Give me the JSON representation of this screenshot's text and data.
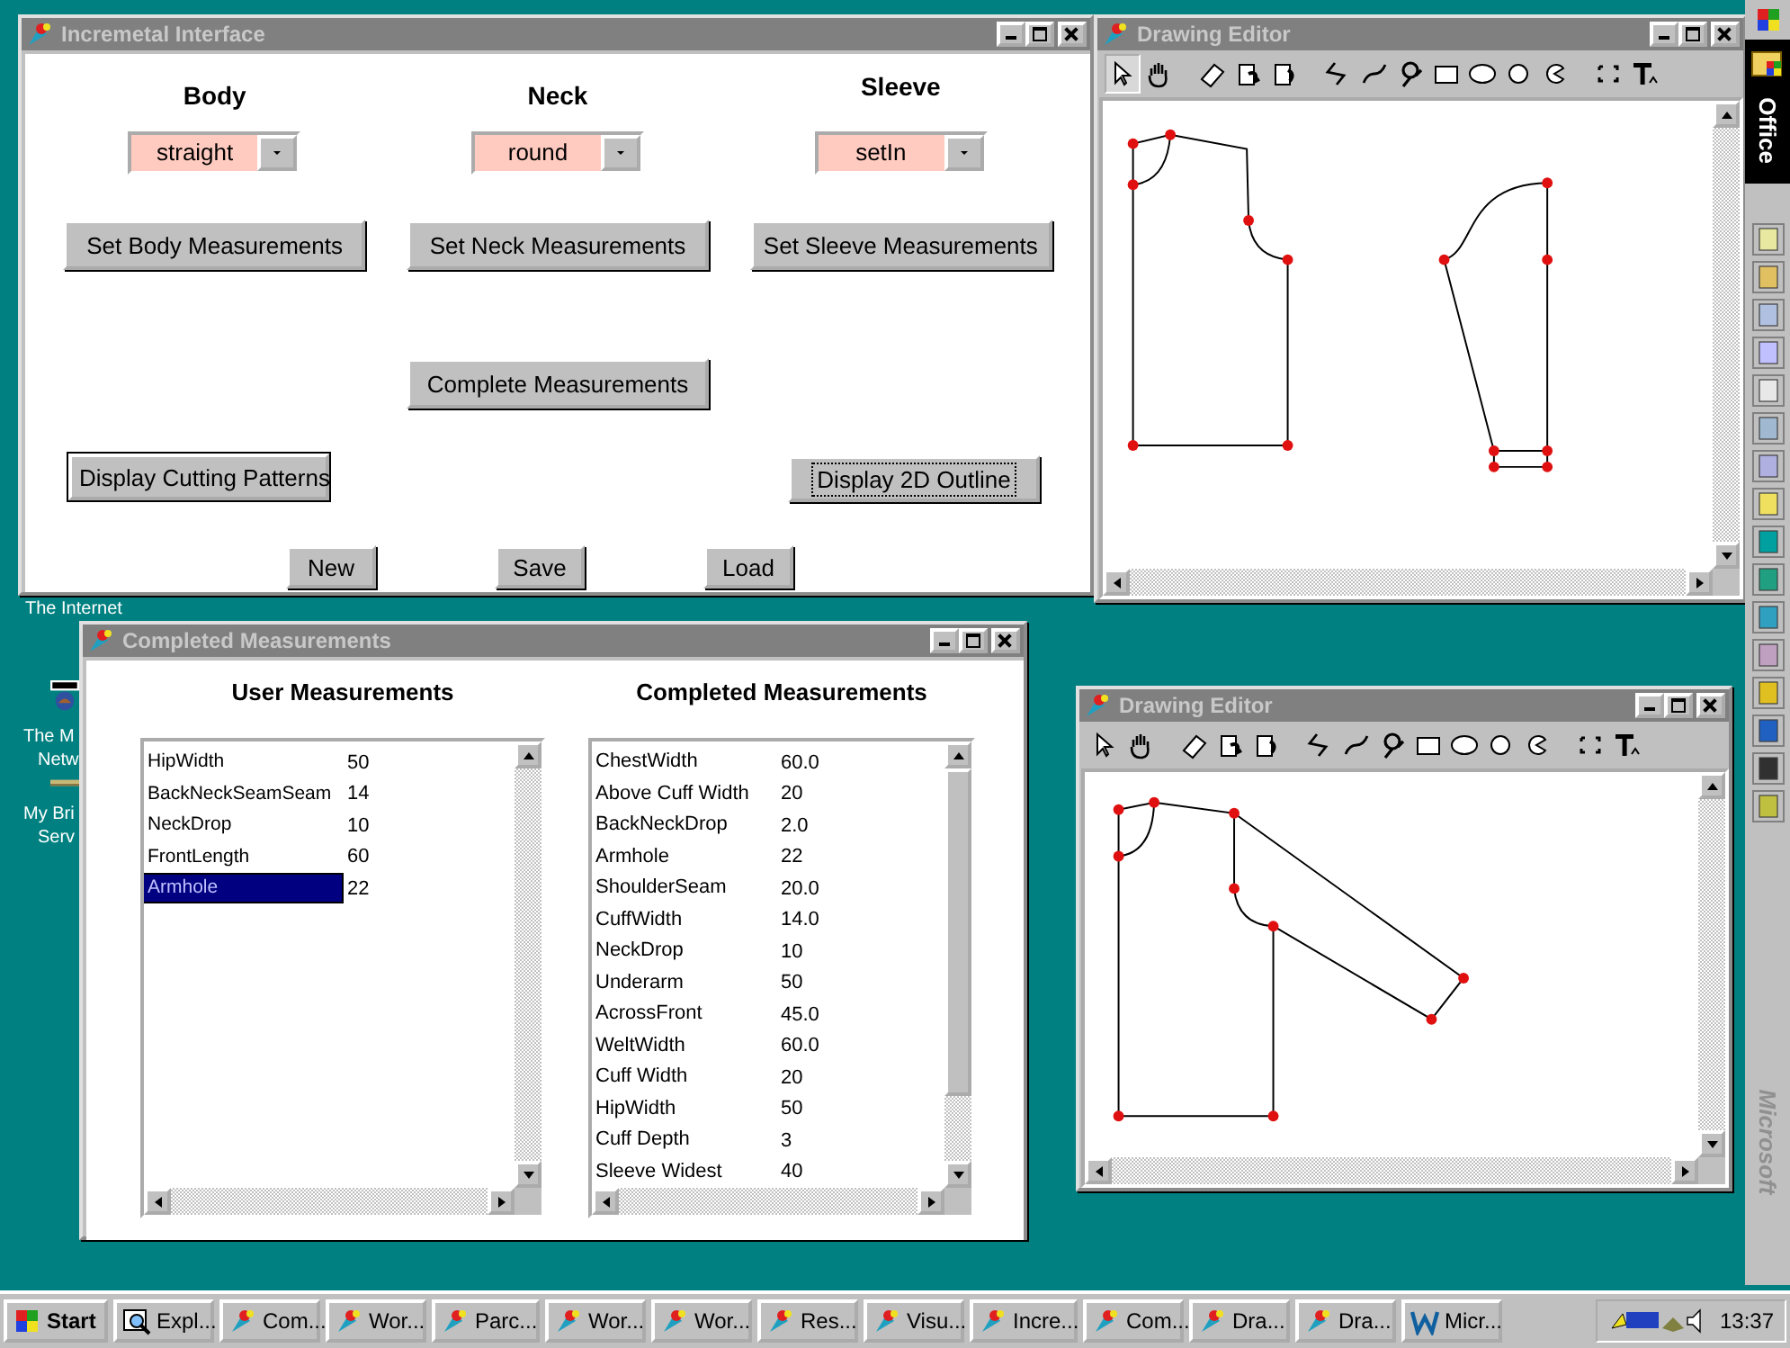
{
  "desktop_icons": [
    {
      "lines": [
        "The Internet"
      ]
    },
    {
      "lines": [
        "The M",
        "Netw"
      ]
    },
    {
      "lines": [
        "My Bri",
        "Serv"
      ]
    }
  ],
  "main_window": {
    "title": "Incremetal Interface",
    "columns": [
      {
        "heading": "Body",
        "choice": "straight",
        "button": "Set Body Measurements"
      },
      {
        "heading": "Neck",
        "choice": "round",
        "button": "Set Neck Measurements"
      },
      {
        "heading": "Sleeve",
        "choice": "setIn",
        "button": "Set Sleeve Measurements"
      }
    ],
    "complete_button": "Complete Measurements",
    "display_buttons": [
      {
        "label": "Display Cutting Patterns",
        "default": true,
        "focused": false
      },
      {
        "label": "Display 2D Outline",
        "default": false,
        "focused": true
      }
    ],
    "file_buttons": [
      "New",
      "Save",
      "Load"
    ]
  },
  "measurements_window": {
    "title": "Completed Measurements",
    "user_heading": "User Measurements",
    "user_rows": [
      {
        "name": "HipWidth",
        "value": "50",
        "selected": false
      },
      {
        "name": "BackNeckSeamSeam",
        "value": "14",
        "selected": false
      },
      {
        "name": "NeckDrop",
        "value": "10",
        "selected": false
      },
      {
        "name": "FrontLength",
        "value": "60",
        "selected": false
      },
      {
        "name": "Armhole",
        "value": "22",
        "selected": true
      }
    ],
    "completed_heading": "Completed Measurements",
    "completed_rows": [
      {
        "name": "ChestWidth",
        "value": "60.0"
      },
      {
        "name": "Above Cuff Width",
        "value": "20"
      },
      {
        "name": "BackNeckDrop",
        "value": "2.0"
      },
      {
        "name": "Armhole",
        "value": "22"
      },
      {
        "name": "ShoulderSeam",
        "value": "20.0"
      },
      {
        "name": "CuffWidth",
        "value": "14.0"
      },
      {
        "name": "NeckDrop",
        "value": "10"
      },
      {
        "name": "Underarm",
        "value": "50"
      },
      {
        "name": "AcrossFront",
        "value": "45.0"
      },
      {
        "name": "WeltWidth",
        "value": "60.0"
      },
      {
        "name": "Cuff Width",
        "value": "20"
      },
      {
        "name": "HipWidth",
        "value": "50"
      },
      {
        "name": "Cuff Depth",
        "value": "3"
      },
      {
        "name": "Sleeve Widest",
        "value": "40"
      }
    ]
  },
  "drawing_editors": [
    {
      "title": "Drawing Editor",
      "tools": [
        {
          "selected": true
        },
        {
          "selected": false
        },
        {
          "selected": false
        },
        {
          "selected": false
        },
        {
          "selected": false
        },
        {
          "selected": false
        },
        {
          "selected": false
        },
        {
          "selected": false
        },
        {
          "selected": false
        },
        {
          "selected": false
        },
        {
          "selected": false
        },
        {
          "selected": false
        },
        {
          "selected": false
        },
        {
          "selected": false
        }
      ]
    },
    {
      "title": "Drawing Editor",
      "tools": [
        {
          "selected": false
        },
        {
          "selected": false
        },
        {
          "selected": false
        },
        {
          "selected": false
        },
        {
          "selected": false
        },
        {
          "selected": false
        },
        {
          "selected": false
        },
        {
          "selected": false
        },
        {
          "selected": false
        },
        {
          "selected": false
        },
        {
          "selected": false
        },
        {
          "selected": false
        },
        {
          "selected": false
        },
        {
          "selected": false
        }
      ]
    }
  ],
  "office_bar": {
    "title": "Office",
    "brand": "Microsoft"
  },
  "taskbar": {
    "start": "Start",
    "items": [
      {
        "label": "Expl...",
        "kind": "explorer"
      },
      {
        "label": "Com...",
        "kind": "app"
      },
      {
        "label": "Wor...",
        "kind": "app"
      },
      {
        "label": "Parc...",
        "kind": "app"
      },
      {
        "label": "Wor...",
        "kind": "app"
      },
      {
        "label": "Wor...",
        "kind": "app"
      },
      {
        "label": "Res...",
        "kind": "app"
      },
      {
        "label": "Visu...",
        "kind": "app"
      },
      {
        "label": "Incre...",
        "kind": "app"
      },
      {
        "label": "Com...",
        "kind": "app"
      },
      {
        "label": "Dra...",
        "kind": "app"
      },
      {
        "label": "Dra...",
        "kind": "app"
      },
      {
        "label": "Micr...",
        "kind": "word"
      }
    ],
    "clock": "13:37"
  }
}
